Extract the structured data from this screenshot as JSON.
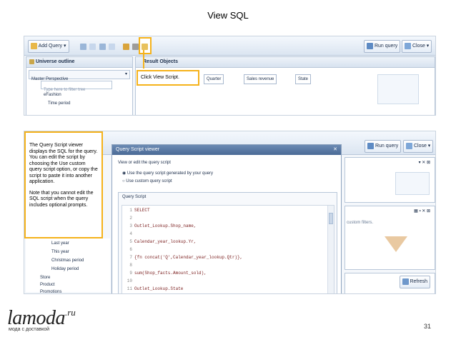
{
  "slide": {
    "title": "View SQL",
    "page_number": "31"
  },
  "logo": {
    "name": "lamoda",
    "superscript": ".ru",
    "tagline": "мода с доставкой"
  },
  "screen1": {
    "toolbar": {
      "add_query": "Add Query",
      "run_query": "Run query",
      "close": "Close"
    },
    "universe_outline": "Universe outline",
    "perspective": "Master Perspective",
    "filter_placeholder": "Type here to filter tree",
    "tree": [
      "eFashion",
      "Time period"
    ],
    "result_objects": "Result Objects",
    "chips": [
      "Quarter",
      "Sales revenue",
      "State"
    ],
    "callout": "Click View Script."
  },
  "screen2": {
    "info_box": {
      "para1": "The Query Script viewer displays the SQL for the query. You can edit the script by choosing the Use custom query script option, or copy the script to paste it into another application.",
      "para2": "Note that you cannot edit the SQL script when the query includes optional prompts."
    },
    "dialog": {
      "title": "Query Script viewer",
      "prompt": "View or edit the query script",
      "option_generated": "Use the query script generated by your query",
      "option_custom": "Use custom query script",
      "script_label": "Query Script"
    },
    "code_lines": [
      {
        "n": "1",
        "t": "SELECT"
      },
      {
        "n": "2",
        "t": ""
      },
      {
        "n": "3",
        "t": "Outlet_Lookup.Shop_name,"
      },
      {
        "n": "4",
        "t": ""
      },
      {
        "n": "5",
        "t": "Calendar_year_lookup.Yr,"
      },
      {
        "n": "6",
        "t": ""
      },
      {
        "n": "7",
        "t": "{fn concat('Q',Calendar_year_lookup.Qtr)},"
      },
      {
        "n": "8",
        "t": ""
      },
      {
        "n": "9",
        "t": "sum(Shop_facts.Amount_sold),"
      },
      {
        "n": "10",
        "t": ""
      },
      {
        "n": "11",
        "t": "Outlet_Lookup.State"
      }
    ],
    "tree_items": [
      "Last year",
      "This year",
      "Christmas period",
      "Holiday period",
      "Store",
      "Product",
      "Promotions"
    ],
    "run_query": "Run query",
    "close": "Close",
    "custom_filters": "custom filters.",
    "refresh": "Refresh"
  },
  "colors": {
    "callout_border": "#f5b21a",
    "dialog_title": "#4a6a96",
    "toolbar": "#dbe5f1"
  }
}
